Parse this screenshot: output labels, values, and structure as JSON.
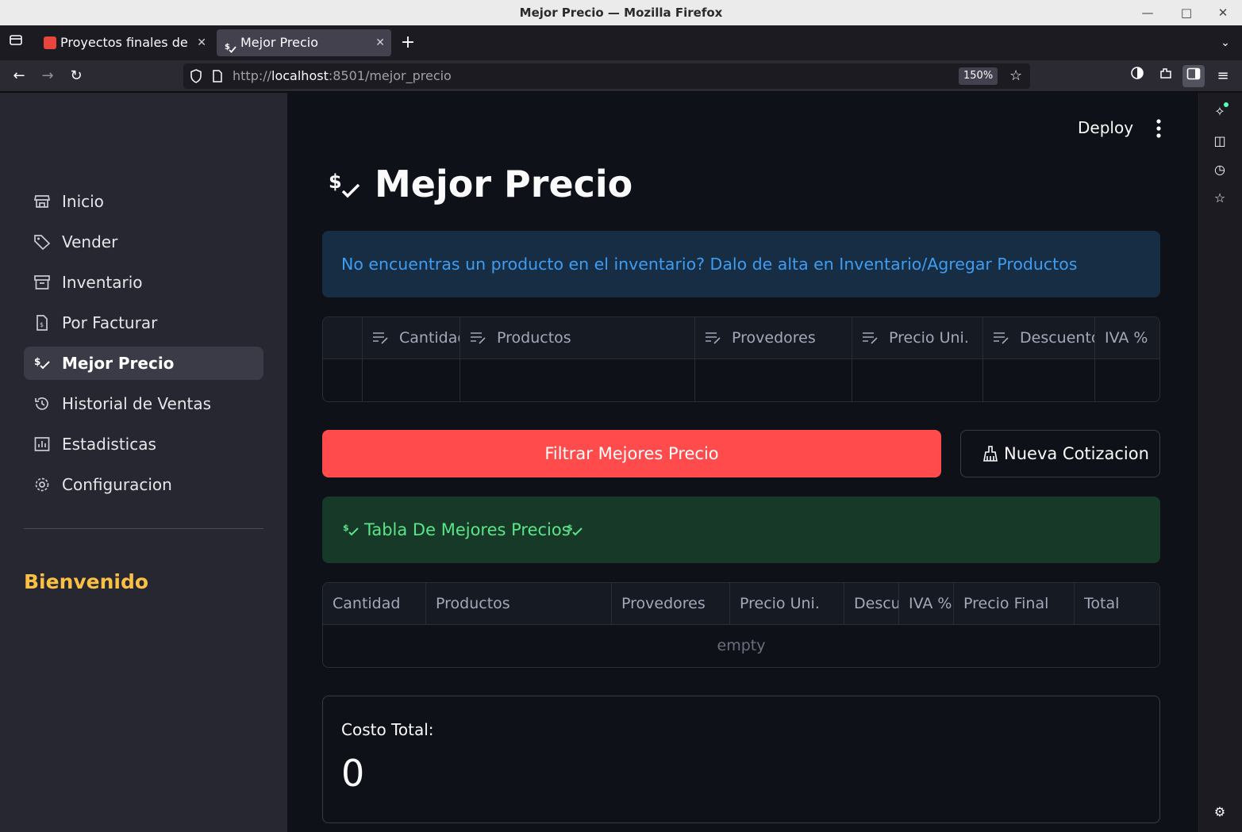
{
  "window": {
    "title": "Mejor Precio — Mozilla Firefox"
  },
  "tabs": [
    {
      "label": "Proyectos finales de",
      "active": false,
      "icon": "gmail-icon"
    },
    {
      "label": "Mejor Precio",
      "active": true,
      "icon": "money-check-icon"
    }
  ],
  "urlbar": {
    "protocol": "http://",
    "host": "localhost",
    "path": ":8501/mejor_precio",
    "zoom": "150%"
  },
  "header": {
    "deploy_label": "Deploy"
  },
  "sidebar": {
    "items": [
      {
        "label": "Inicio",
        "icon": "store-icon",
        "active": false
      },
      {
        "label": "Vender",
        "icon": "tag-icon",
        "active": false
      },
      {
        "label": "Inventario",
        "icon": "archive-icon",
        "active": false
      },
      {
        "label": "Por Facturar",
        "icon": "invoice-icon",
        "active": false
      },
      {
        "label": "Mejor Precio",
        "icon": "price-check-icon",
        "active": true
      },
      {
        "label": "Historial de Ventas",
        "icon": "history-icon",
        "active": false
      },
      {
        "label": "Estadisticas",
        "icon": "chart-icon",
        "active": false
      },
      {
        "label": "Configuracion",
        "icon": "gear-icon",
        "active": false
      }
    ],
    "welcome": "Bienvenido"
  },
  "main": {
    "title": "Mejor Precio",
    "info_message": "No encuentras un producto en el inventario? Dalo de alta en Inventario/Agregar Productos",
    "editor_table": {
      "columns": [
        "Cantidad",
        "Productos",
        "Provedores",
        "Precio Uni.",
        "Descuento",
        "IVA %"
      ]
    },
    "buttons": {
      "filter": "Filtrar Mejores Precio",
      "new_quote": "Nueva Cotizacion"
    },
    "success_message": "Tabla De Mejores Precios",
    "result_table": {
      "columns": [
        "Cantidad",
        "Productos",
        "Provedores",
        "Precio Uni.",
        "Descuento",
        "IVA %",
        "Precio Final",
        "Total"
      ],
      "empty_label": "empty"
    },
    "metric": {
      "label": "Costo Total:",
      "value": "0"
    }
  },
  "colors": {
    "primary": "#ff4b4b",
    "info_text": "#3d9df3",
    "success_text": "#5ce488",
    "welcome": "#fbbf46",
    "background": "#0e1117",
    "sidebar": "#262730"
  }
}
